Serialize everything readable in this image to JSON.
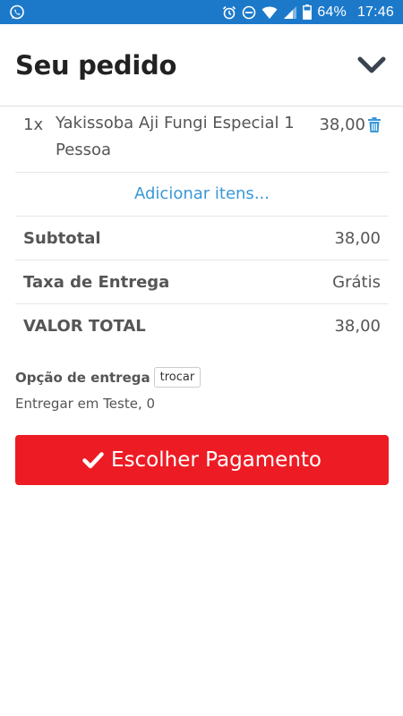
{
  "status_bar": {
    "left_icon": "whatsapp-icon",
    "icons": [
      "alarm-icon",
      "do-not-disturb-icon",
      "wifi-icon",
      "signal-icon",
      "battery-icon"
    ],
    "battery": "64%",
    "time": "17:46",
    "background": "#1c79ca"
  },
  "header": {
    "title": "Seu pedido",
    "collapse_icon": "chevron-down-icon"
  },
  "order": {
    "items": [
      {
        "qty": "1x",
        "name": "Yakissoba Aji Fungi Especial 1 Pessoa",
        "price": "38,00",
        "delete_icon": "trash-icon"
      }
    ],
    "add_items_label": "Adicionar itens..."
  },
  "summary": {
    "subtotal_label": "Subtotal",
    "subtotal_value": "38,00",
    "delivery_fee_label": "Taxa de Entrega",
    "delivery_fee_value": "Grátis",
    "total_label": "VALOR TOTAL",
    "total_value": "38,00"
  },
  "delivery": {
    "option_label": "Opção de entrega",
    "change_label": "trocar",
    "address": "Entregar em Teste, 0"
  },
  "payment": {
    "button_label": "Escolher Pagamento",
    "button_icon": "check-icon",
    "button_color": "#ed1c24"
  },
  "colors": {
    "link": "#3a98d8",
    "trash": "#3a98d8"
  }
}
